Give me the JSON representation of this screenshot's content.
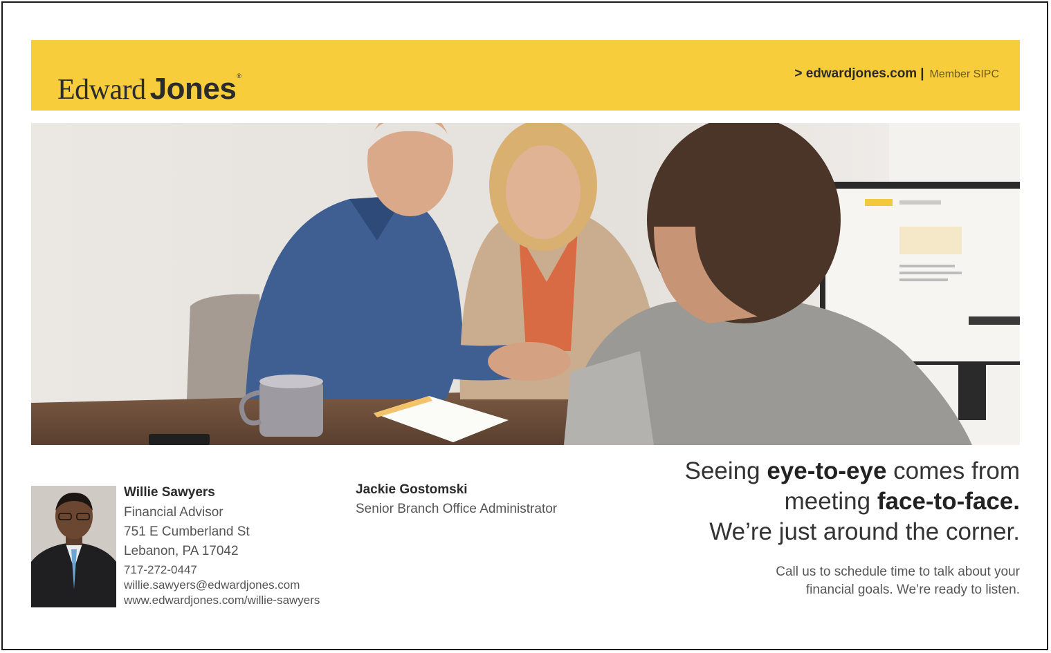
{
  "banner": {
    "logo_edward": "Edward",
    "logo_jones": "Jones",
    "logo_reg": "®",
    "url": "> edwardjones.com",
    "separator": "|",
    "member": "Member SIPC"
  },
  "colors": {
    "banner_yellow": "#f7cd3b",
    "text_dark": "#2b2b2b",
    "text_gray": "#555555"
  },
  "advisor": {
    "name": "Willie Sawyers",
    "title": "Financial Advisor",
    "address1": "751 E Cumberland St",
    "address2": "Lebanon, PA 17042",
    "phone": "717-272-0447",
    "email": "willie.sawyers@edwardjones.com",
    "web": "www.edwardjones.com/willie-sawyers"
  },
  "admin": {
    "name": "Jackie Gostomski",
    "title": "Senior Branch Office Administrator"
  },
  "headline": {
    "l1a": "Seeing ",
    "l1b": "eye-to-eye",
    "l1c": " comes from",
    "l2a": "meeting ",
    "l2b": "face-to-face.",
    "l3": "We’re just around the corner."
  },
  "subtext": {
    "l1": "Call us to schedule time to talk about your",
    "l2": "financial goals. We’re ready to listen."
  }
}
